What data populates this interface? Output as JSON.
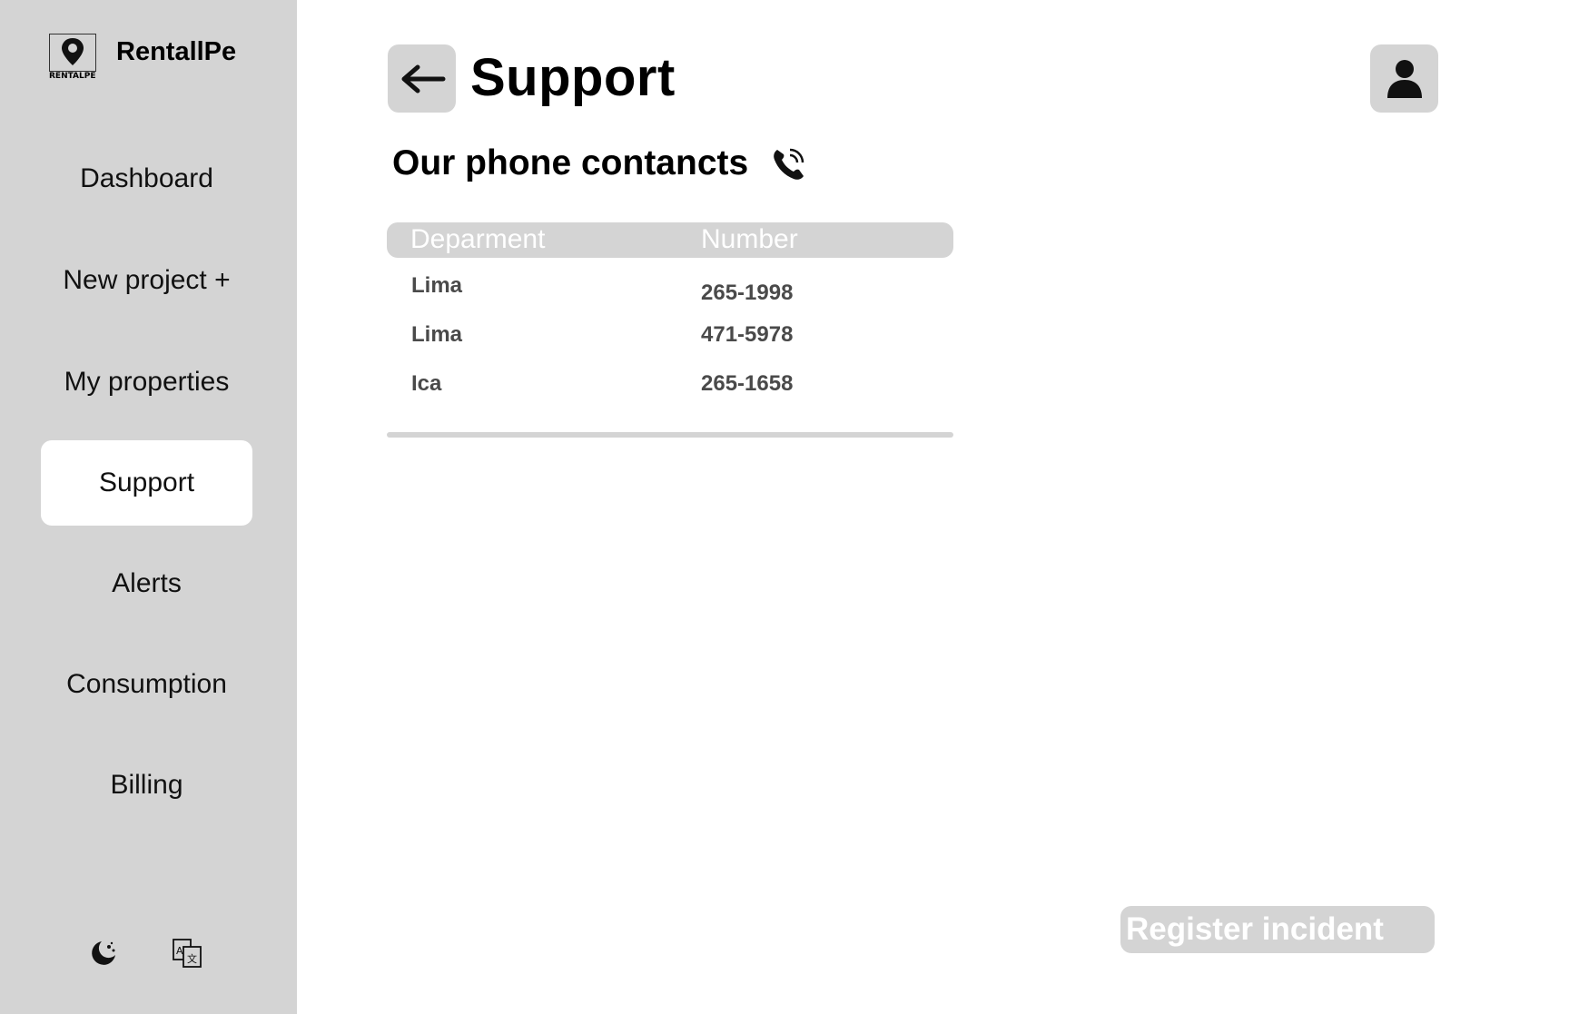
{
  "sidebar": {
    "brand_name": "RentallPe",
    "logo_wordmark": "RENTALPE",
    "items": [
      {
        "label": "Dashboard"
      },
      {
        "label": "New project +"
      },
      {
        "label": "My properties"
      },
      {
        "label": "Support",
        "active": true
      },
      {
        "label": "Alerts"
      },
      {
        "label": "Consumption"
      },
      {
        "label": "Billing"
      }
    ],
    "bottom_icons": [
      "theme-icon",
      "translate-icon"
    ]
  },
  "header": {
    "title": "Support",
    "back_icon": "arrow-left-icon",
    "profile_icon": "user-icon"
  },
  "contacts": {
    "title": "Our phone contancts",
    "icon": "phone-call-icon",
    "columns": [
      "Deparment",
      "Number"
    ],
    "rows": [
      {
        "department": "Lima",
        "number": "265-1998"
      },
      {
        "department": "Lima",
        "number": "471-5978"
      },
      {
        "department": "Ica",
        "number": "265-1658"
      }
    ]
  },
  "actions": {
    "register_label": "Register incident"
  },
  "colors": {
    "sidebar_bg": "#d4d4d4",
    "active_item_bg": "#ffffff",
    "muted_text": "#4a4a4a"
  }
}
